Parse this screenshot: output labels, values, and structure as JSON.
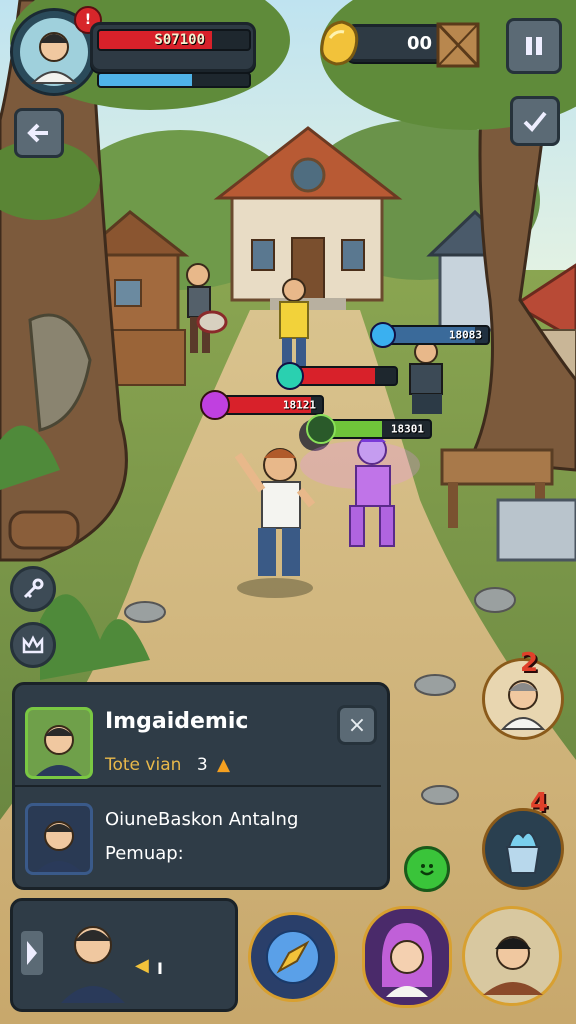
{
  "hud": {
    "player_score": "S07100",
    "player_health_pct": 0.75,
    "player_mana_pct": 0.62,
    "alert_badge": "!",
    "coin_count": "00",
    "colors": {
      "health": "#d8212a",
      "mana": "#4fb3e8"
    }
  },
  "units": {
    "blue_unit_value": "18083",
    "red_unit_value": "18121",
    "green_unit_value": "18301",
    "teal_bar_pct": 0.8,
    "red_bar_pct": 0.9,
    "green_bar_pct": 0.55,
    "blue_bar_pct": 0.88
  },
  "side_badges": {
    "top_badge": "2",
    "bottom_badge": "4"
  },
  "dialog": {
    "title": "Imgaidemic",
    "subtitle": "Tote vian",
    "subtitle_count": "3",
    "body_line1": "OiuneBaskon Antalng",
    "body_line2": "Pemuap:",
    "close_label": "×"
  },
  "bottom_bar": {
    "player_count": "I"
  },
  "icons": {
    "back": "arrow-left-icon",
    "pause": "pause-icon",
    "check": "checkmark-icon",
    "key": "key-icon",
    "crown": "crown-icon",
    "compass": "compass-icon",
    "smiley": "smiley-icon"
  }
}
